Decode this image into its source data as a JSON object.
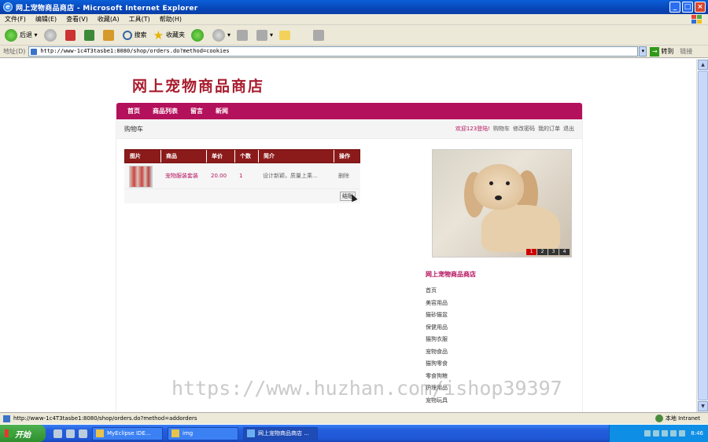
{
  "window": {
    "title": "网上宠物商品商店 - Microsoft Internet Explorer",
    "controls": [
      "_",
      "□",
      "×"
    ]
  },
  "menu": [
    "文件(F)",
    "编辑(E)",
    "查看(V)",
    "收藏(A)",
    "工具(T)",
    "帮助(H)"
  ],
  "toolbar": {
    "back": "后退",
    "search": "搜索",
    "favorites": "收藏夹"
  },
  "address": {
    "label": "地址(D)",
    "url": "http://www-1c4T3tasbe1:8080/shop/orders.do?method=cookies",
    "go": "转到",
    "links": "链接"
  },
  "page": {
    "shop_title": "网上宠物商品商店",
    "nav": [
      "首页",
      "商品列表",
      "留言",
      "新闻"
    ],
    "breadcrumb": "购物车",
    "user": {
      "welcome": "欢迎123登陆!",
      "links": [
        "购物车",
        "修改密码",
        "我的订单",
        "退出"
      ]
    },
    "cart": {
      "headers": [
        "图片",
        "商品",
        "单价",
        "个数",
        "简介",
        "操作"
      ],
      "rows": [
        {
          "product": "宠物服装套装",
          "price": "20.00",
          "qty": "1",
          "desc": "设计新颖，质量上乘...",
          "action": "删除"
        }
      ],
      "checkout": "结账"
    },
    "carousel": {
      "pages": [
        "1",
        "2",
        "3",
        "4"
      ],
      "active": 1
    },
    "side": {
      "title": "网上宠物商品商店",
      "items": [
        "首页",
        "美容用品",
        "猫砂猫盆",
        "保健用品",
        "猫狗衣服",
        "宠物食品",
        "猫狗零食",
        "零食狗粮",
        "护理用品",
        "宠物玩具"
      ]
    },
    "watermark": "https://www.huzhan.com/ishop39397"
  },
  "status": {
    "url": "http://www-1c4T3tasbe1:8080/shop/orders.do?method=addorders",
    "zone": "本地 Intranet"
  },
  "taskbar": {
    "start": "开始",
    "tasks": [
      "MyEclipse IDE...",
      "img",
      "网上宠物商品商店 ..."
    ],
    "clock": "8:46"
  }
}
